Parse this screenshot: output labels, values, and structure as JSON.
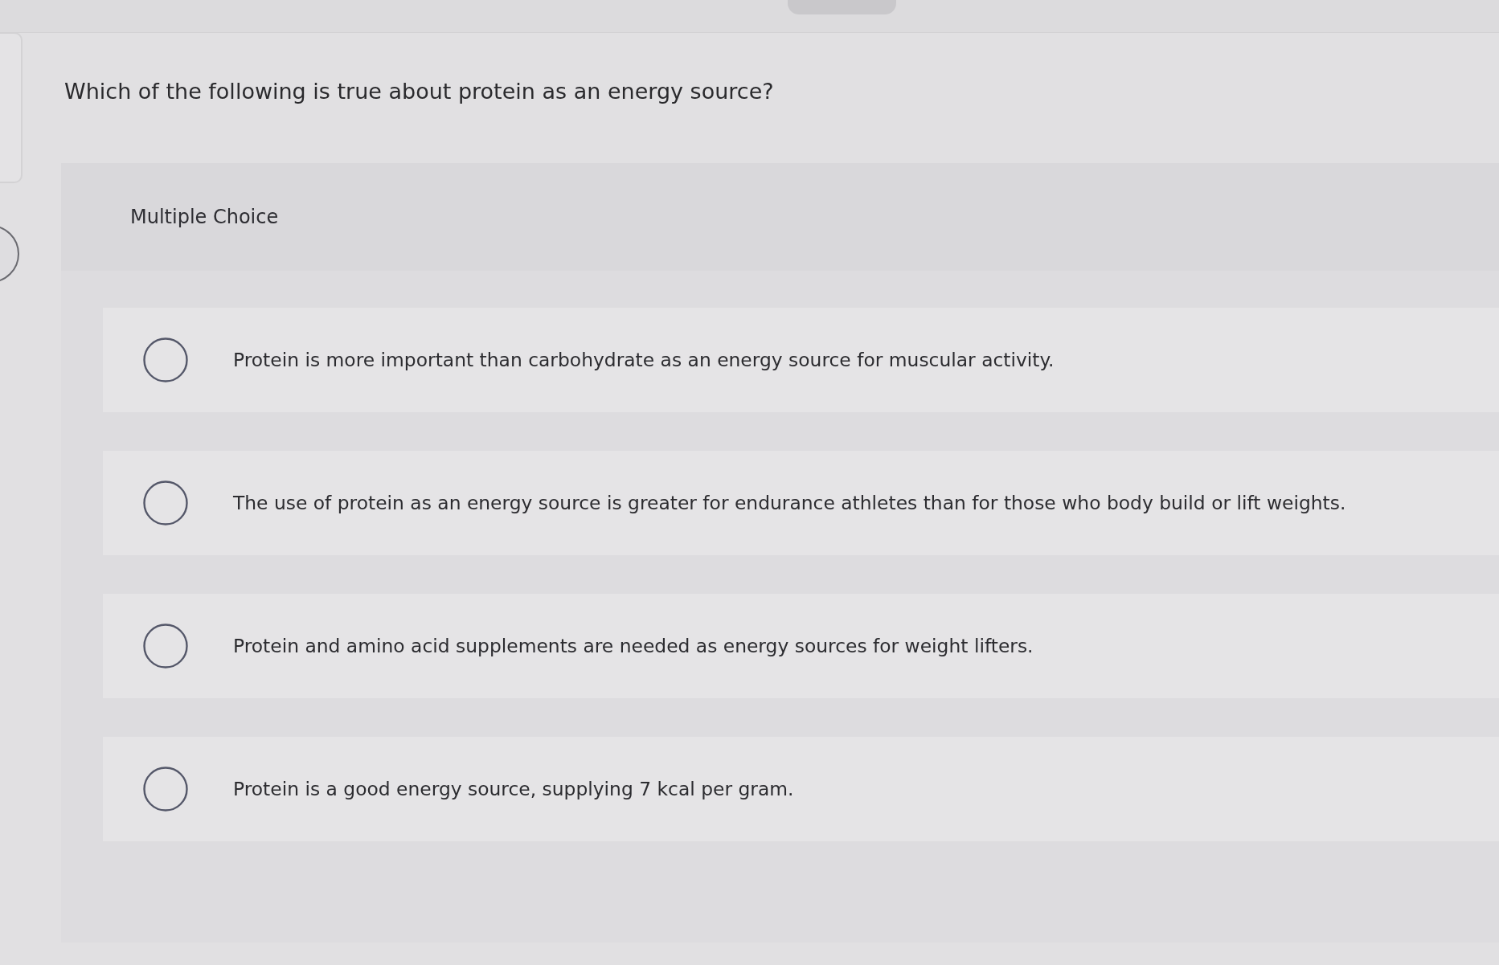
{
  "question": "Which of the following is true about protein as an energy source?",
  "panel": {
    "label": "Multiple Choice"
  },
  "options": [
    {
      "text": "Protein is more important than carbohydrate as an energy source for muscular activity.",
      "selected": false
    },
    {
      "text": "The use of protein as an energy source is greater for endurance athletes than for those who body build or lift weights.",
      "selected": false
    },
    {
      "text": "Protein and amino acid supplements are needed as energy sources for weight lifters.",
      "selected": false
    },
    {
      "text": "Protein is a good energy source, supplying 7 kcal per gram.",
      "selected": false
    }
  ]
}
